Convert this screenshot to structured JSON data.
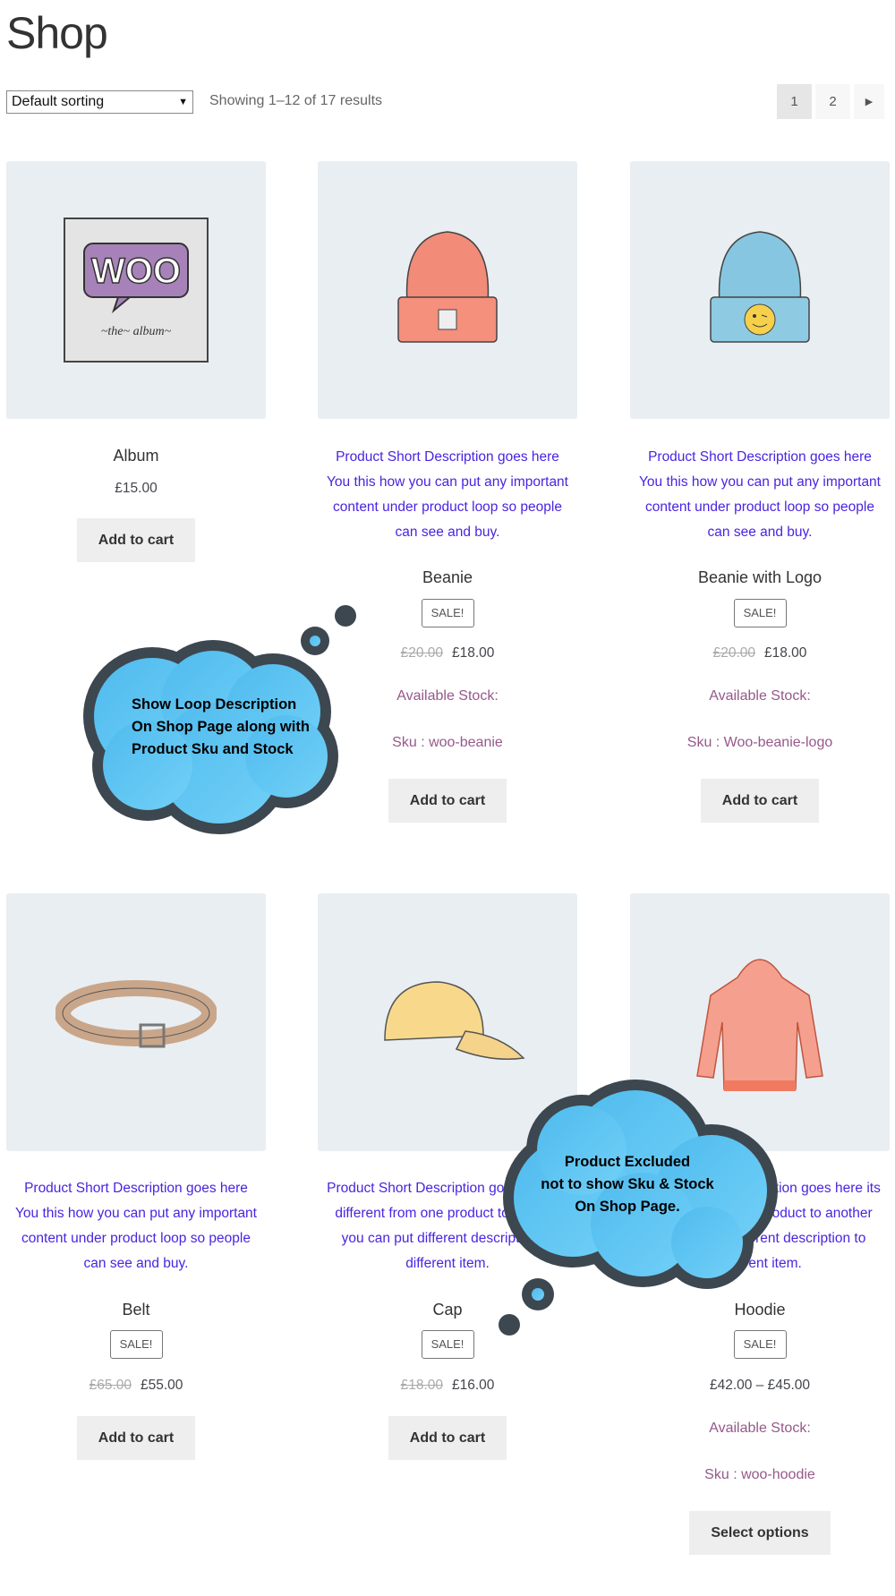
{
  "page": {
    "title": "Shop"
  },
  "toolbar": {
    "sort_selected": "Default sorting",
    "result_count": "Showing 1–12 of 17 results"
  },
  "pagination": {
    "pages": [
      "1",
      "2"
    ],
    "current": "1",
    "next_icon": "triangle-right-icon"
  },
  "products": [
    {
      "title": "Album",
      "price": "£15.00",
      "button": "Add to cart",
      "image": "album-image"
    },
    {
      "title": "Beanie",
      "description": [
        "Product Short Description goes here",
        "You this how you can put any important",
        "content under product loop so people",
        "can see and buy."
      ],
      "badge": "SALE!",
      "old_price": "£20.00",
      "price": "£18.00",
      "stock": "Available Stock:",
      "sku": "Sku : woo-beanie",
      "button": "Add to cart",
      "image": "beanie-image"
    },
    {
      "title": "Beanie with Logo",
      "description": [
        "Product Short Description goes here",
        "You this how you can put any important",
        "content under product loop so people",
        "can see and buy."
      ],
      "badge": "SALE!",
      "old_price": "£20.00",
      "price": "£18.00",
      "stock": "Available Stock:",
      "sku": "Sku : Woo-beanie-logo",
      "button": "Add to cart",
      "image": "beanie-logo-image"
    },
    {
      "title": "Belt",
      "description": [
        "Product Short Description goes here",
        "You this how you can put any important",
        "content under product loop so people",
        "can see and buy."
      ],
      "badge": "SALE!",
      "old_price": "£65.00",
      "price": "£55.00",
      "button": "Add to cart",
      "image": "belt-image"
    },
    {
      "title": "Cap",
      "description": [
        "Product Short Description goes here its",
        "different from one product to another",
        "you can put different description to",
        "different item."
      ],
      "badge": "SALE!",
      "old_price": "£18.00",
      "price": "£16.00",
      "button": "Add to cart",
      "image": "cap-image"
    },
    {
      "title": "Hoodie",
      "description": [
        "Product Short Description goes here its",
        "different from one product to another",
        "you can put different description to",
        "different item."
      ],
      "badge": "SALE!",
      "price": "£42.00 – £45.00",
      "stock": "Available Stock:",
      "sku": "Sku : woo-hoodie",
      "button": "Select options",
      "image": "hoodie-image"
    }
  ],
  "callouts": [
    {
      "lines": [
        "Show Loop Description",
        "On Shop Page along with",
        "Product Sku and Stock"
      ]
    },
    {
      "lines": [
        "Product Excluded",
        "not to show Sku & Stock",
        "On Shop Page."
      ]
    }
  ],
  "colors": {
    "description": "#4a24e0",
    "meta": "#96588a",
    "card_bg": "#e9eef2",
    "button_bg": "#eeeeee",
    "bubble": "#5bc4f5",
    "bubble_border": "#3d4750"
  }
}
